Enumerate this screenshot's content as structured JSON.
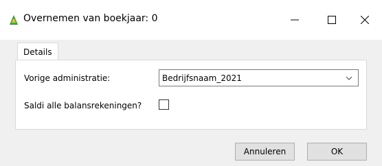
{
  "window": {
    "title": "Overnemen van boekjaar: 0",
    "app_icon": "green-leaf-app-icon",
    "controls": {
      "minimize": "minimize-icon",
      "maximize": "maximize-icon",
      "close": "close-icon"
    }
  },
  "tabs": [
    {
      "label": "Details"
    }
  ],
  "form": {
    "previous_admin": {
      "label": "Vorige administratie:",
      "value": "Bedrijfsnaam_2021"
    },
    "saldi": {
      "label": "Saldi alle balansrekeningen?",
      "checked": false
    }
  },
  "buttons": {
    "cancel": "Annuleren",
    "ok": "OK"
  }
}
